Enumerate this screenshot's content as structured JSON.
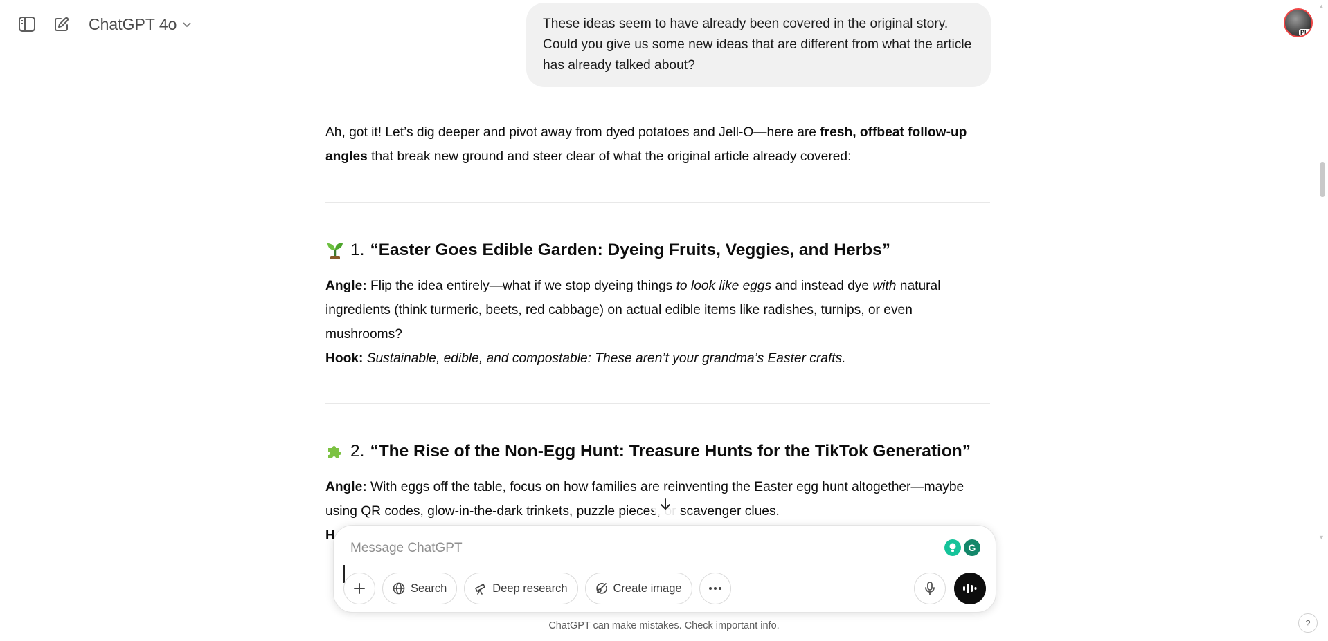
{
  "topbar": {
    "model_label": "ChatGPT 4o",
    "avatar_badge": "PLUS"
  },
  "user_message": "These ideas seem to have already been covered in the original story. Could you give us some new ideas that are different from what the article has already talked about?",
  "assistant": {
    "intro_plain_1": "Ah, got it! Let’s dig deeper and pivot away from dyed potatoes and Jell-O—here are ",
    "intro_bold": "fresh, offbeat follow-up angles",
    "intro_plain_2": " that break new ground and steer clear of what the original article already covered:",
    "sections": [
      {
        "emoji": "seedling",
        "number": "1.",
        "title": "“Easter Goes Edible Garden: Dyeing Fruits, Veggies, and Herbs”",
        "angle_label": "Angle:",
        "angle_text_1": " Flip the idea entirely—what if we stop dyeing things ",
        "angle_italic_1": "to look like eggs",
        "angle_text_2": " and instead dye ",
        "angle_italic_2": "with",
        "angle_text_3": " natural ingredients (think turmeric, beets, red cabbage) on actual edible items like radishes, turnips, or even mushrooms?",
        "hook_label": "Hook:",
        "hook_text": " Sustainable, edible, and compostable: These aren’t your grandma’s Easter crafts."
      },
      {
        "emoji": "puzzle",
        "number": "2.",
        "title": "“The Rise of the Non-Egg Hunt: Treasure Hunts for the TikTok Generation”",
        "angle_label": "Angle:",
        "angle_text_1": " With eggs off the table, focus on how families are reinventing the Easter egg hunt altogether—maybe using QR codes, glow-in-the-dark trinkets, puzzle pieces, or scavenger clues.",
        "hook_label": "H"
      }
    ]
  },
  "composer": {
    "placeholder": "Message ChatGPT",
    "tools": {
      "search": "Search",
      "deep_research": "Deep research",
      "create_image": "Create image"
    }
  },
  "footer_note": "ChatGPT can make mistakes. Check important info.",
  "help_label": "?",
  "colors": {
    "bubble_bg": "#f1f1f1",
    "grammarly_green": "#15c39a",
    "voice_button": "#0d0d0d"
  }
}
